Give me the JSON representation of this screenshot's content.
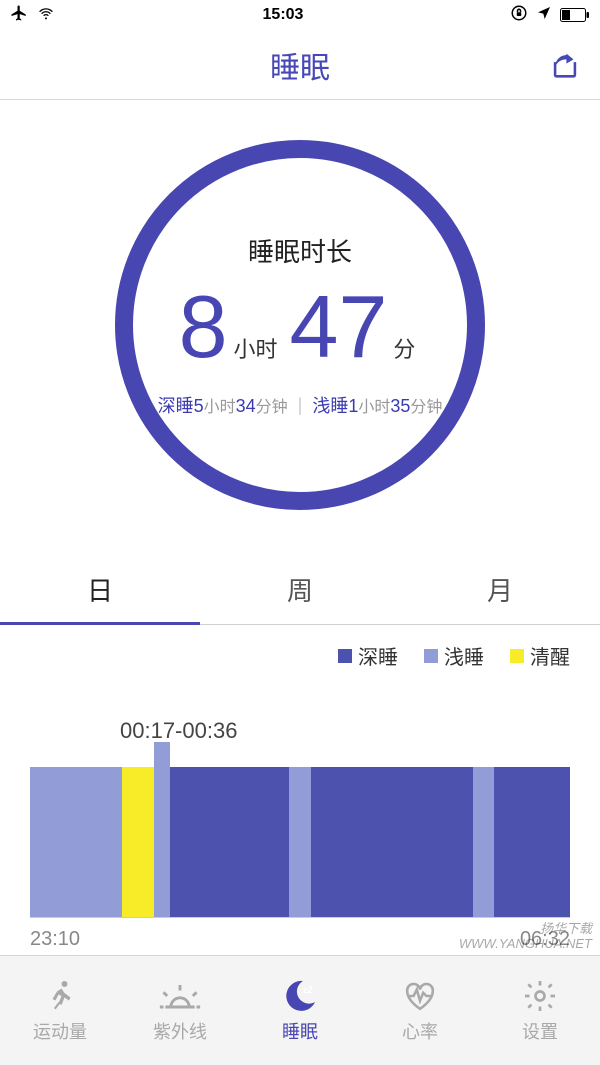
{
  "status": {
    "time": "15:03"
  },
  "header": {
    "title": "睡眠"
  },
  "colors": {
    "primary": "#4746B3",
    "deep": "#4C52AE",
    "light": "#929CD7",
    "awake": "#F8EB27"
  },
  "circle": {
    "label": "睡眠时长",
    "hours_value": "8",
    "hours_unit": "小时",
    "minutes_value": "47",
    "minutes_unit": "分",
    "deep_label": "深睡",
    "deep_hours": "5",
    "deep_h_unit": "小时",
    "deep_minutes": "34",
    "deep_m_unit": "分钟",
    "light_label": "浅睡",
    "light_hours": "1",
    "light_h_unit": "小时",
    "light_minutes": "35",
    "light_m_unit": "分钟"
  },
  "range_tabs": {
    "day": "日",
    "week": "周",
    "month": "月",
    "active": 0
  },
  "legend": {
    "deep": "深睡",
    "light": "浅睡",
    "awake": "清醒"
  },
  "chart_data": {
    "type": "bar",
    "tooltip": "00:17-00:36",
    "x_start": "23:10",
    "x_end": "06:32",
    "segments": [
      {
        "kind": "light",
        "pct": 17
      },
      {
        "kind": "awake",
        "pct": 6
      },
      {
        "kind": "light",
        "pct": 3,
        "bump": true
      },
      {
        "kind": "deep",
        "pct": 22
      },
      {
        "kind": "light",
        "pct": 4
      },
      {
        "kind": "deep",
        "pct": 30
      },
      {
        "kind": "light",
        "pct": 4
      },
      {
        "kind": "deep",
        "pct": 14
      }
    ]
  },
  "nav": {
    "items": [
      {
        "key": "activity",
        "label": "运动量"
      },
      {
        "key": "uv",
        "label": "紫外线"
      },
      {
        "key": "sleep",
        "label": "睡眠",
        "active": true
      },
      {
        "key": "heart",
        "label": "心率"
      },
      {
        "key": "settings",
        "label": "设置"
      }
    ]
  },
  "watermark": {
    "l1": "扬华下载",
    "l2": "WWW.YANGHUA.NET"
  }
}
